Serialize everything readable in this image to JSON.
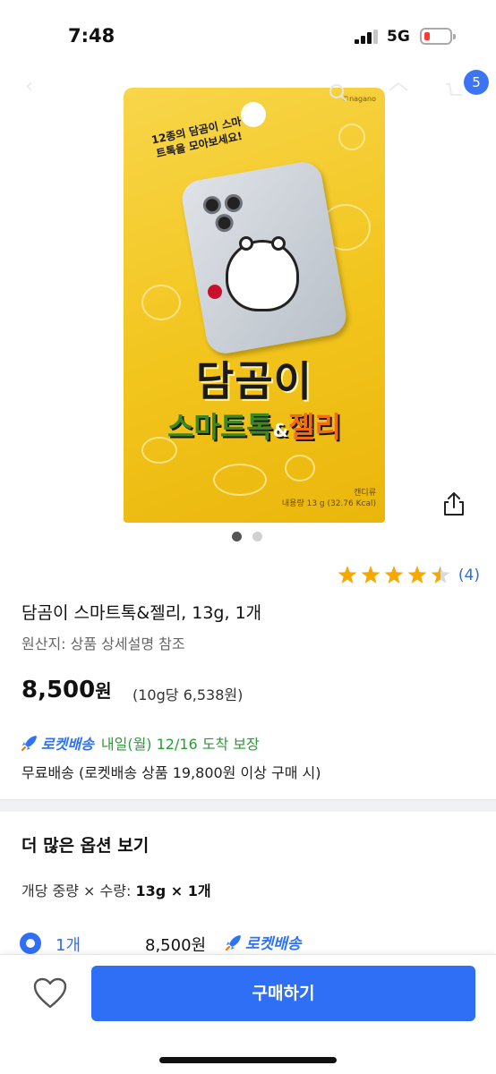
{
  "status_bar": {
    "time": "7:48",
    "network": "5G",
    "battery_color": "#ff3b30"
  },
  "header": {
    "cart_count": "5",
    "icons": [
      "search-icon",
      "home-icon",
      "cart-icon"
    ]
  },
  "gallery": {
    "page_count": 2,
    "active_index": 0,
    "packaging": {
      "brand": "©nagano",
      "note": "12종의 담곰이 스마트톡을 모아보세요!",
      "title_line1": "담곰이",
      "title_line2_a": "스마트톡",
      "title_line2_amp": "&",
      "title_line2_b": "젤리",
      "category": "캔디류",
      "weight": "내용량 13 g (32.76 Kcal)"
    }
  },
  "rating": {
    "stars": 4.5,
    "count_text": "(4)"
  },
  "product": {
    "title": "담곰이 스마트톡&젤리, 13g, 1개",
    "origin": "원산지: 상품 상세설명 참조",
    "price": "8,500",
    "currency": "원",
    "unit_price": "(10g당 6,538원)"
  },
  "delivery": {
    "rocket_label": "로켓배송",
    "arrival": "내일(월) 12/16 도착 보장",
    "free_shipping": "무료배송 (로켓배송 상품 19,800원 이상 구매 시)"
  },
  "options": {
    "title": "더 많은 옵션 보기",
    "spec_label": "개당 중량 × 수량: ",
    "spec_value": "13g × 1개",
    "items": [
      {
        "qty": "1개",
        "price": "8,500원",
        "rocket_label": "로켓배송",
        "selected": true
      }
    ]
  },
  "bottom_bar": {
    "buy_label": "구매하기"
  },
  "colors": {
    "accent": "#2f6ff5",
    "rating_star": "#f7a800",
    "rocket_blue": "#2f74f6",
    "delivery_green": "#2c9a37"
  }
}
